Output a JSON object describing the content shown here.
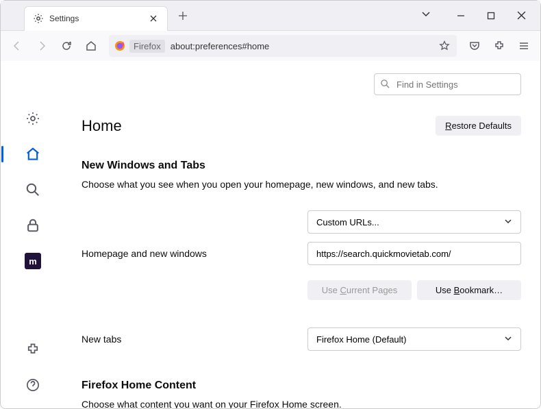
{
  "tab": {
    "title": "Settings"
  },
  "urlbar": {
    "protocol_label": "Firefox",
    "url": "about:preferences#home"
  },
  "search": {
    "placeholder": "Find in Settings"
  },
  "heading": "Home",
  "restore_btn": "Restore Defaults",
  "section1": {
    "title": "New Windows and Tabs",
    "desc": "Choose what you see when you open your homepage, new windows, and new tabs.",
    "homepage_select": "Custom URLs...",
    "homepage_label": "Homepage and new windows",
    "homepage_url": "https://search.quickmovietab.com/",
    "use_current": "Use Current Pages",
    "use_bookmark": "Use Bookmark…",
    "newtabs_label": "New tabs",
    "newtabs_select": "Firefox Home (Default)"
  },
  "section2": {
    "title": "Firefox Home Content",
    "desc": "Choose what content you want on your Firefox Home screen."
  },
  "moz": "m"
}
